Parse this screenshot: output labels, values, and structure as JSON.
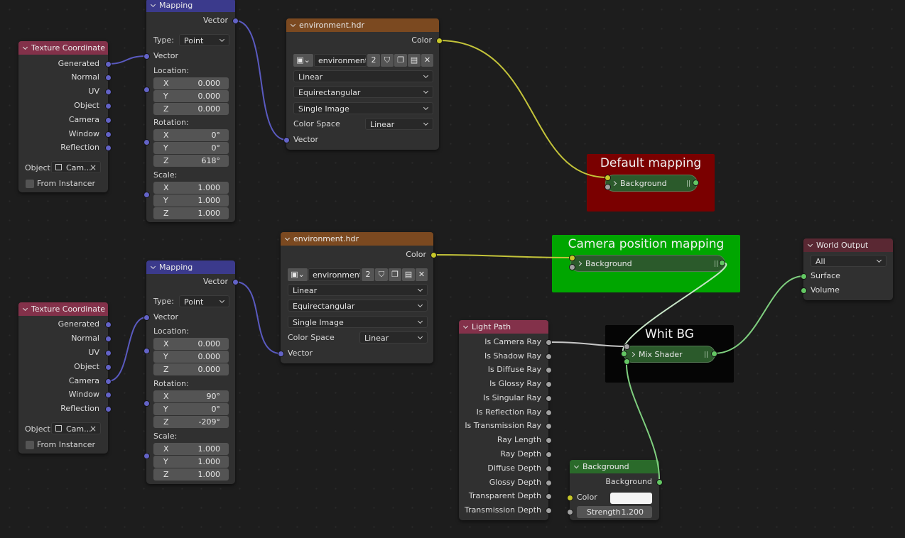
{
  "nodes": {
    "texcoord1": {
      "title": "Texture Coordinate",
      "outputs": [
        "Generated",
        "Normal",
        "UV",
        "Object",
        "Camera",
        "Window",
        "Reflection"
      ],
      "object_label": "Object:",
      "object_value": "Cam...",
      "from_instancer": "From Instancer"
    },
    "texcoord2": {
      "title": "Texture Coordinate",
      "outputs": [
        "Generated",
        "Normal",
        "UV",
        "Object",
        "Camera",
        "Window",
        "Reflection"
      ],
      "object_label": "Object:",
      "object_value": "Cam...",
      "from_instancer": "From Instancer"
    },
    "mapping1": {
      "title": "Mapping",
      "output": "Vector",
      "type_label": "Type:",
      "type_value": "Point",
      "input_vector": "Vector",
      "location_label": "Location:",
      "location": [
        "0.000",
        "0.000",
        "0.000"
      ],
      "rotation_label": "Rotation:",
      "rotation": [
        "0°",
        "0°",
        "618°"
      ],
      "scale_label": "Scale:",
      "scale": [
        "1.000",
        "1.000",
        "1.000"
      ],
      "axes": [
        "X",
        "Y",
        "Z"
      ]
    },
    "mapping2": {
      "title": "Mapping",
      "output": "Vector",
      "type_label": "Type:",
      "type_value": "Point",
      "input_vector": "Vector",
      "location_label": "Location:",
      "location": [
        "0.000",
        "0.000",
        "0.000"
      ],
      "rotation_label": "Rotation:",
      "rotation": [
        "90°",
        "0°",
        "-209°"
      ],
      "scale_label": "Scale:",
      "scale": [
        "1.000",
        "1.000",
        "1.000"
      ],
      "axes": [
        "X",
        "Y",
        "Z"
      ]
    },
    "env1": {
      "title": "environment.hdr",
      "output": "Color",
      "image_name": "environment...",
      "users": "2",
      "interpolation": "Linear",
      "projection": "Equirectangular",
      "source": "Single Image",
      "color_space_label": "Color Space",
      "color_space": "Linear",
      "input": "Vector"
    },
    "env2": {
      "title": "environment.hdr",
      "output": "Color",
      "image_name": "environment...",
      "users": "2",
      "interpolation": "Linear",
      "projection": "Equirectangular",
      "source": "Single Image",
      "color_space_label": "Color Space",
      "color_space": "Linear",
      "input": "Vector"
    },
    "lightpath": {
      "title": "Light Path",
      "outputs": [
        "Is Camera Ray",
        "Is Shadow Ray",
        "Is Diffuse Ray",
        "Is Glossy Ray",
        "Is Singular Ray",
        "Is Reflection Ray",
        "Is Transmission Ray",
        "Ray Length",
        "Ray Depth",
        "Diffuse Depth",
        "Glossy Depth",
        "Transparent Depth",
        "Transmission Depth"
      ]
    },
    "background": {
      "title": "Background",
      "output": "Background",
      "color_label": "Color",
      "color_value": "#f4f4f4",
      "strength_label": "Strength",
      "strength_value": "1.200"
    },
    "world_output": {
      "title": "World Output",
      "target": "All",
      "inputs": [
        "Surface",
        "Volume"
      ]
    }
  },
  "frames": {
    "default": {
      "title": "Default mapping",
      "color": "#7a0000",
      "node_label": "Background"
    },
    "camera": {
      "title": "Camera position mapping",
      "color": "#00a600",
      "node_label": "Background"
    },
    "white": {
      "title": "Whit BG",
      "color": "#050505",
      "node_label": "Mix Shader"
    }
  },
  "colors": {
    "vector_socket": "#6363c7",
    "color_socket": "#c7c729",
    "shader_socket": "#63c763",
    "float_socket": "#a1a1a1",
    "vector_wire": "#5a5ac0",
    "color_wire": "#c4c43a",
    "shader_wire": "#7fcf7f",
    "float_wire": "#c8c8c8"
  },
  "icons": [
    "collapse-chevron-icon",
    "image-icon",
    "shield-icon",
    "duplicate-icon",
    "pack-icon",
    "close-icon",
    "object-icon",
    "grip-icon"
  ]
}
